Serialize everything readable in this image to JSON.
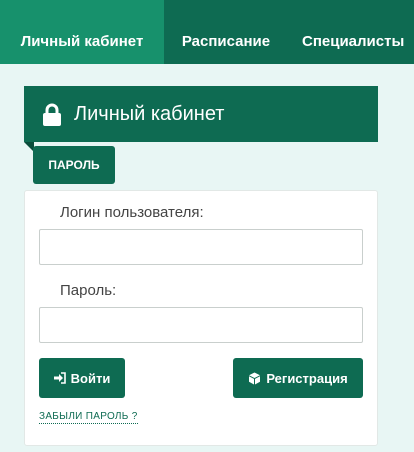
{
  "nav": {
    "tabs": [
      {
        "label": "Личный кабинет",
        "active": true
      },
      {
        "label": "Расписание",
        "active": false
      },
      {
        "label": "Специалисты",
        "active": false
      }
    ]
  },
  "panel": {
    "title": "Личный кабинет",
    "icon": "lock-icon",
    "subtab_label": "ПАРОЛЬ"
  },
  "form": {
    "login_label": "Логин пользователя:",
    "login_value": "",
    "password_label": "Пароль:",
    "password_value": "",
    "login_button": "Войти",
    "register_button": "Регистрация",
    "forgot_link": "ЗАБЫЛИ ПАРОЛЬ ?"
  },
  "colors": {
    "primary": "#0e6b52",
    "primary_active": "#17916c",
    "background": "#e8f6f4"
  }
}
